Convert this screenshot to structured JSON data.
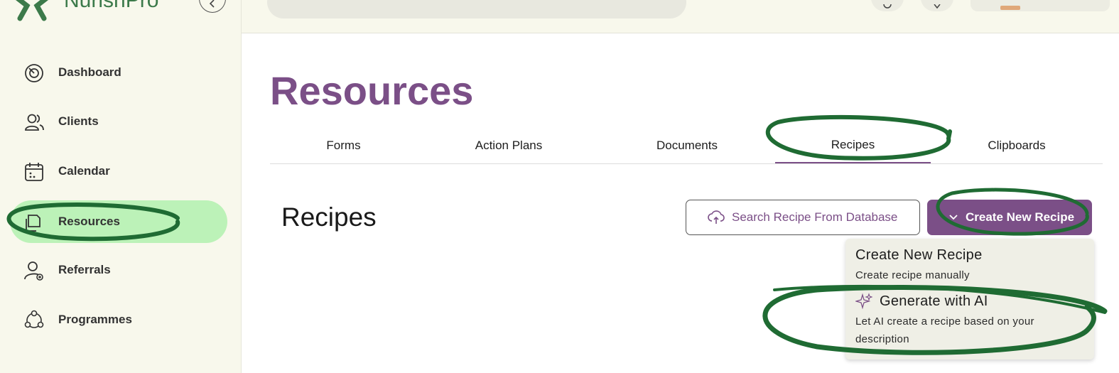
{
  "brand": {
    "name": "NurishPro",
    "logo_color": "#3c7a4a",
    "collapse_icon": "chevron-left-icon"
  },
  "sidebar": {
    "items": [
      {
        "label": "Dashboard",
        "icon": "dashboard-gauge-icon",
        "active": false
      },
      {
        "label": "Clients",
        "icon": "users-icon",
        "active": false
      },
      {
        "label": "Calendar",
        "icon": "calendar-icon",
        "active": false
      },
      {
        "label": "Resources",
        "icon": "documents-stack-icon",
        "active": true
      },
      {
        "label": "Referrals",
        "icon": "user-plus-icon",
        "active": false
      },
      {
        "label": "Programmes",
        "icon": "network-circle-icon",
        "active": false
      }
    ]
  },
  "page": {
    "title": "Resources"
  },
  "tabs": [
    {
      "label": "Forms",
      "active": false
    },
    {
      "label": "Action Plans",
      "active": false
    },
    {
      "label": "Documents",
      "active": false
    },
    {
      "label": "Recipes",
      "active": true
    },
    {
      "label": "Clipboards",
      "active": false
    }
  ],
  "section": {
    "title": "Recipes",
    "search_button": "Search Recipe From Database",
    "create_button": "Create New Recipe"
  },
  "dropdown": {
    "items": [
      {
        "title": "Create New Recipe",
        "description": "Create recipe manually",
        "icon": ""
      },
      {
        "title": "Generate with AI",
        "description": "Let AI create a recipe based on your description",
        "icon": "sparkles-icon"
      }
    ]
  },
  "colors": {
    "accent": "#7b4f87",
    "active_nav": "#bcf2b8",
    "sidebar_bg": "#f8f8ec",
    "annotation": "#1f6b33"
  }
}
